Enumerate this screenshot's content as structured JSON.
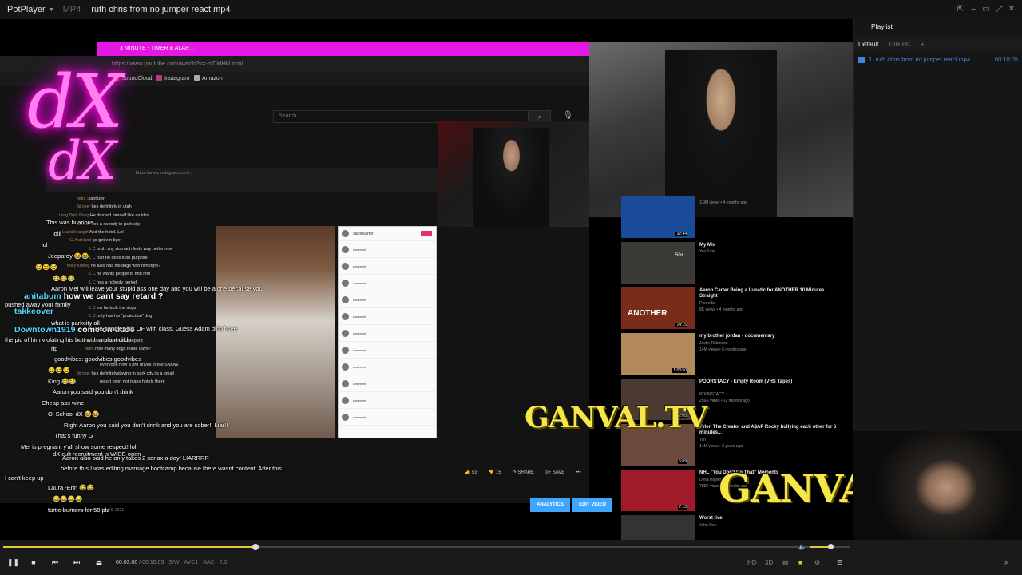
{
  "window": {
    "brand": "PotPlayer",
    "format": "MP4",
    "title": "ruth chris from no jumper react.mp4"
  },
  "playlist": {
    "title": "Playlist",
    "tabs": [
      "Default",
      "This PC",
      "+"
    ],
    "items": [
      {
        "label": "1. ruth chris from no jumper react.mp4",
        "duration": "00:10:05"
      }
    ]
  },
  "video": {
    "browser_tab": "3 MINUTE - TIMER & ALAR…",
    "browser_tab_prefix": "dX cult",
    "url": "https://www.youtube.com/watch?v=-mDldHkUnml",
    "bookmarks": [
      "SoundCloud",
      "Instagram",
      "Amazon"
    ],
    "search_placeholder": "Search",
    "inner_url": "https://www.instagram.com/...",
    "neon_big": "dX",
    "neon_small": "dX",
    "watermark": "GANVAL.TV",
    "chat": [
      {
        "user": "",
        "msg": "This was hilarious"
      },
      {
        "user": "",
        "msg": "lolll"
      },
      {
        "user": "",
        "msg": "lol"
      },
      {
        "user": "",
        "msg": "Jeopardy 😂😂"
      },
      {
        "user": "",
        "msg": "😂😂😂"
      },
      {
        "user": "",
        "msg": "😂😂😂"
      },
      {
        "user": "",
        "msg": "Aaron Mel will leave your stupid ass one day and you will be alone because you"
      },
      {
        "user": "anitabum",
        "msg": "how we cant say retard ?"
      },
      {
        "user": "",
        "msg": "pushed away your family"
      },
      {
        "user": "takkeover",
        "msg": ""
      },
      {
        "user": "",
        "msg": "what is parkcity all"
      },
      {
        "user": "Downtown1919",
        "msg": "come on dude"
      },
      {
        "user": "",
        "msg": "He handles his OF with class. Guess Adam didn't see"
      },
      {
        "user": "",
        "msg": "the pic of him violating his butt with a plant dildo"
      },
      {
        "user": "",
        "msg": "rip"
      },
      {
        "user": "",
        "msg": "goodvibes: goodvibes goodvibes"
      },
      {
        "user": "",
        "msg": "😂😂😂"
      },
      {
        "user": "",
        "msg": "King 😂😂"
      },
      {
        "user": "",
        "msg": "Aaron you said you don't drink"
      },
      {
        "user": "",
        "msg": "Cheap ass wine"
      },
      {
        "user": "",
        "msg": "Ol School dX 😂😂"
      },
      {
        "user": "",
        "msg": "Right Aaron you said you don't drink and you are sober!! Liar!!"
      },
      {
        "user": "",
        "msg": "That's funny G"
      },
      {
        "user": "",
        "msg": "Mel is pregnant y'all show some respect! lol"
      },
      {
        "user": "",
        "msg": "dX cult recruitment is WIDE open"
      },
      {
        "user": "",
        "msg": "Aaron also said he only takes 2 xanax a day! LIARRRR"
      },
      {
        "user": "",
        "msg": "before this I was editing marriage bootcamp because there wasnt content. After this.."
      },
      {
        "user": "",
        "msg": "I can't keep up"
      },
      {
        "user": "",
        "msg": "Laura -Erin 😂😂"
      },
      {
        "user": "",
        "msg": "😂😂😂😂"
      },
      {
        "user": "",
        "msg": "turtle burners for 50 plz"
      }
    ],
    "rt_chat": [
      {
        "user": "petra",
        "msg": ":sanitizer:"
      },
      {
        "user": "3d oner",
        "msg": "hes definitely in utah"
      },
      {
        "user": "Long Duck Dong",
        "msg": "He doxxed himself like an idiot"
      },
      {
        "user": "3d oner",
        "msg": "hes a nobody in park city"
      },
      {
        "user": "LauraTexasgirl",
        "msg": "And the hotel. Lol"
      },
      {
        "user": "KZ Auckland",
        "msg": "go get em tiger"
      },
      {
        "user": "L C",
        "msg": "bruh..my stomach feels way better now"
      },
      {
        "user": "L C",
        "msg": "nah he does it on purpose"
      },
      {
        "user": "mary Korting",
        "msg": "he also has his dogs with him right?"
      },
      {
        "user": "L C",
        "msg": "he wants people to find him"
      },
      {
        "user": "L C",
        "msg": "hes a nobody period!"
      },
      {
        "user": "L C",
        "msg": "ew he took the dogs"
      },
      {
        "user": "L C",
        "msg": "only has his \"protection\" dog"
      },
      {
        "user": "3d oner",
        "msg": "Jolie the German Shepard"
      },
      {
        "user": "petra",
        "msg": "how many dogs these days?"
      },
      {
        "user": "",
        "msg": "everyone how a pro drives in the SNOW."
      },
      {
        "user": "3d oner",
        "msg": "hes definitelystaying in park city its a small"
      },
      {
        "user": "",
        "msg": "resort town not many hotels there"
      }
    ],
    "streamed": "310 views • Streamed live on Feb 16, 2021",
    "actions": {
      "likes": "53",
      "dislikes": "15",
      "share": "SHARE",
      "save": "SAVE"
    },
    "analytics": "ANALYTICS",
    "edit_video": "EDIT VIDEO",
    "recommendations": [
      {
        "title": "",
        "meta": "3.9M views • 4 months ago",
        "duration": "32:44",
        "color": "#1a4a9a"
      },
      {
        "title": "My Mix",
        "meta": "YouTube",
        "duration": "",
        "color": "#3b3a36",
        "badge": "50+"
      },
      {
        "title": "Aaron Carter Being a Lunatic for ANOTHER 10 Minutes Straight",
        "meta": "Poorediz",
        "meta2": "8K views • 4 months ago",
        "duration": "14:15",
        "color": "#7a2c1a",
        "overlay": "ANOTHER"
      },
      {
        "title": "my brother jordan - documentary",
        "meta": "Justin Robinson",
        "meta2": "14M views • 6 months ago",
        "duration": "1:03:50",
        "color": "#b28a5a"
      },
      {
        "title": "POORSTACY - Empty Room (VHS Tapes)",
        "meta": "POORSTACY ♪",
        "meta2": "256K views • 11 months ago",
        "duration": "2:05",
        "color": "#4a3a32"
      },
      {
        "title": "Tyler, The Creator and A$AP Rocky bullying each other for 6 minutes...",
        "meta": "Tori",
        "meta2": "14M views • 2 years ago",
        "duration": "6:09",
        "color": "#6a4a3a"
      },
      {
        "title": "NHL \"You Don't Do That\" Moments",
        "meta": "Delta Highlights",
        "meta2": "785K views • 3 months ago",
        "duration": "7:13",
        "color": "#a01a2a"
      },
      {
        "title": "Worst live",
        "meta": "John Dee",
        "meta2": "",
        "duration": "",
        "color": "#333"
      }
    ]
  },
  "controls": {
    "current": "00:03:00",
    "total": "00:10:05",
    "info": [
      "S/W",
      "AVC1",
      "AAC",
      "2.0"
    ],
    "progress": 0.298,
    "volume": 0.85,
    "right": [
      "HD",
      "3D"
    ]
  }
}
